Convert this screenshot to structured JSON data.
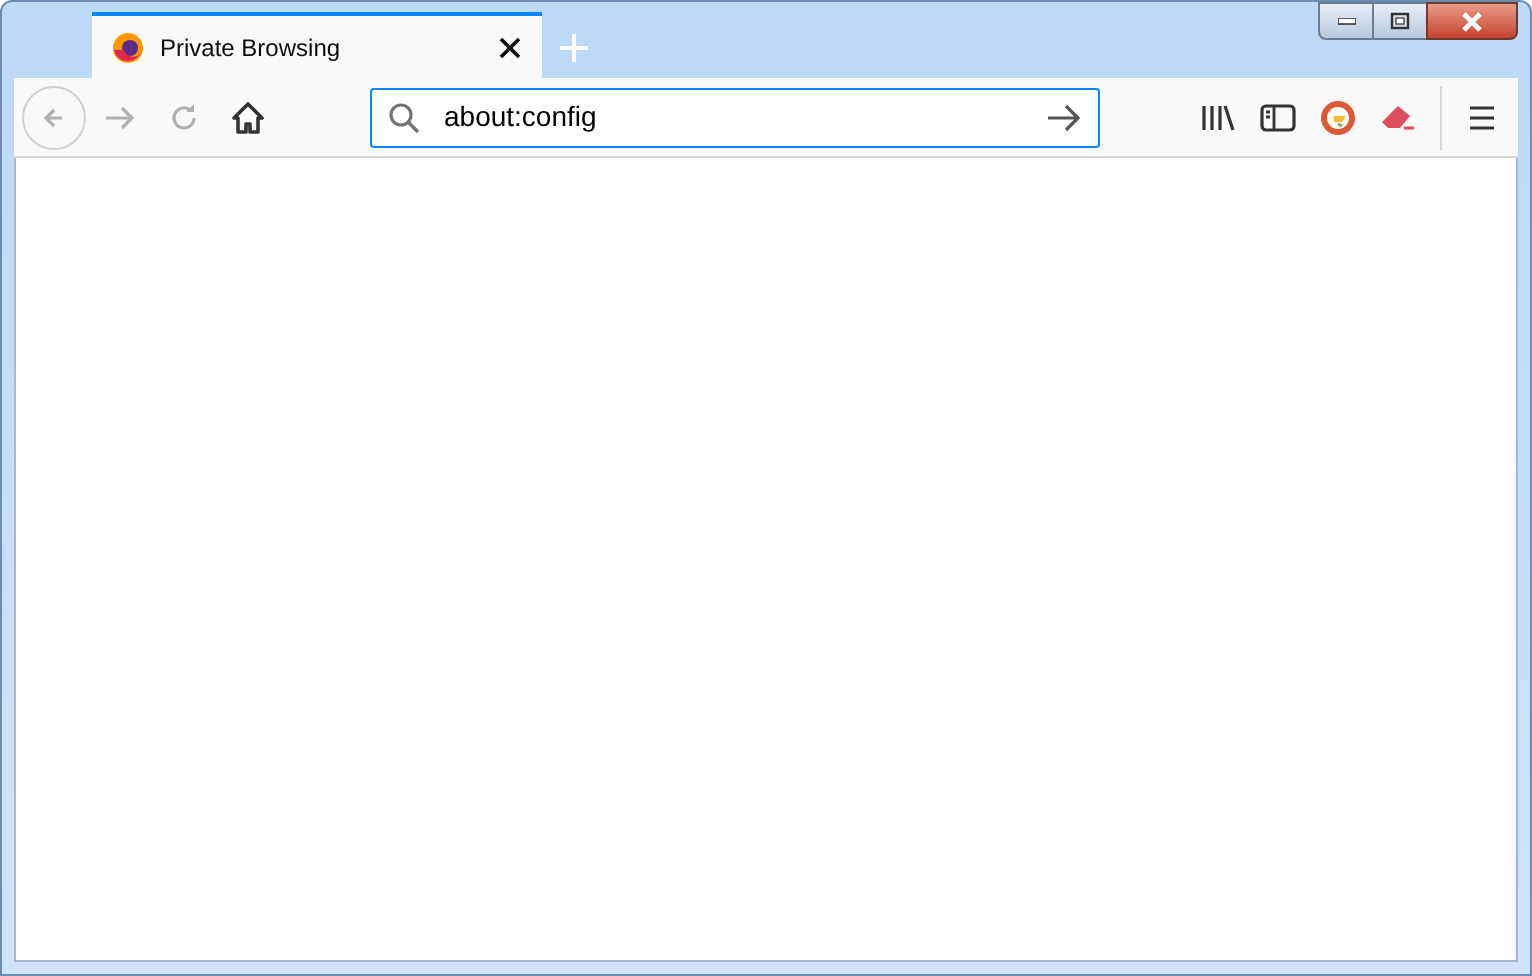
{
  "tabs": [
    {
      "title": "Private Browsing",
      "selected": true
    }
  ],
  "nav": [
    {
      "kind": "back",
      "disabled": true
    },
    {
      "kind": "forward",
      "disabled": true
    },
    {
      "kind": "reload",
      "disabled": true
    },
    {
      "kind": "home",
      "disabled": false
    }
  ],
  "address_bar": {
    "value": "about:config"
  }
}
